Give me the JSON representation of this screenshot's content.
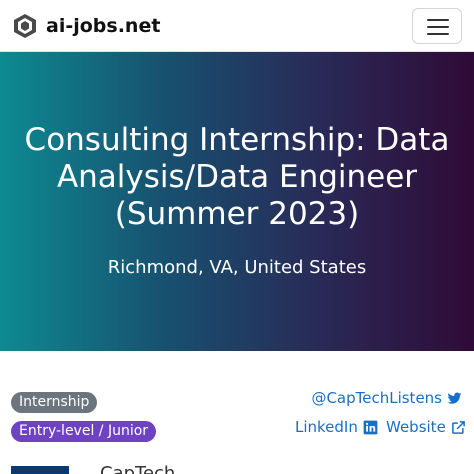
{
  "navbar": {
    "brand": "ai-jobs.net",
    "logo_icon": "ai-jobs-logo-icon",
    "menu_icon": "hamburger-menu-icon"
  },
  "hero": {
    "title": "Consulting Internship: Data Analysis/Data Engineer (Summer 2023)",
    "location": "Richmond, VA, United States",
    "gradient_colors": [
      "#0d8a92",
      "#2a2755",
      "#2f0b36"
    ]
  },
  "badges": {
    "type": "Internship",
    "level": "Entry-level / Junior"
  },
  "links": {
    "twitter": "@CapTechListens",
    "linkedin": "LinkedIn",
    "website": "Website"
  },
  "company": {
    "name_partial": "CapTech"
  },
  "colors": {
    "link": "#1a6fc4",
    "badge_gray": "#6c757d",
    "badge_purple": "#6f42c1"
  }
}
